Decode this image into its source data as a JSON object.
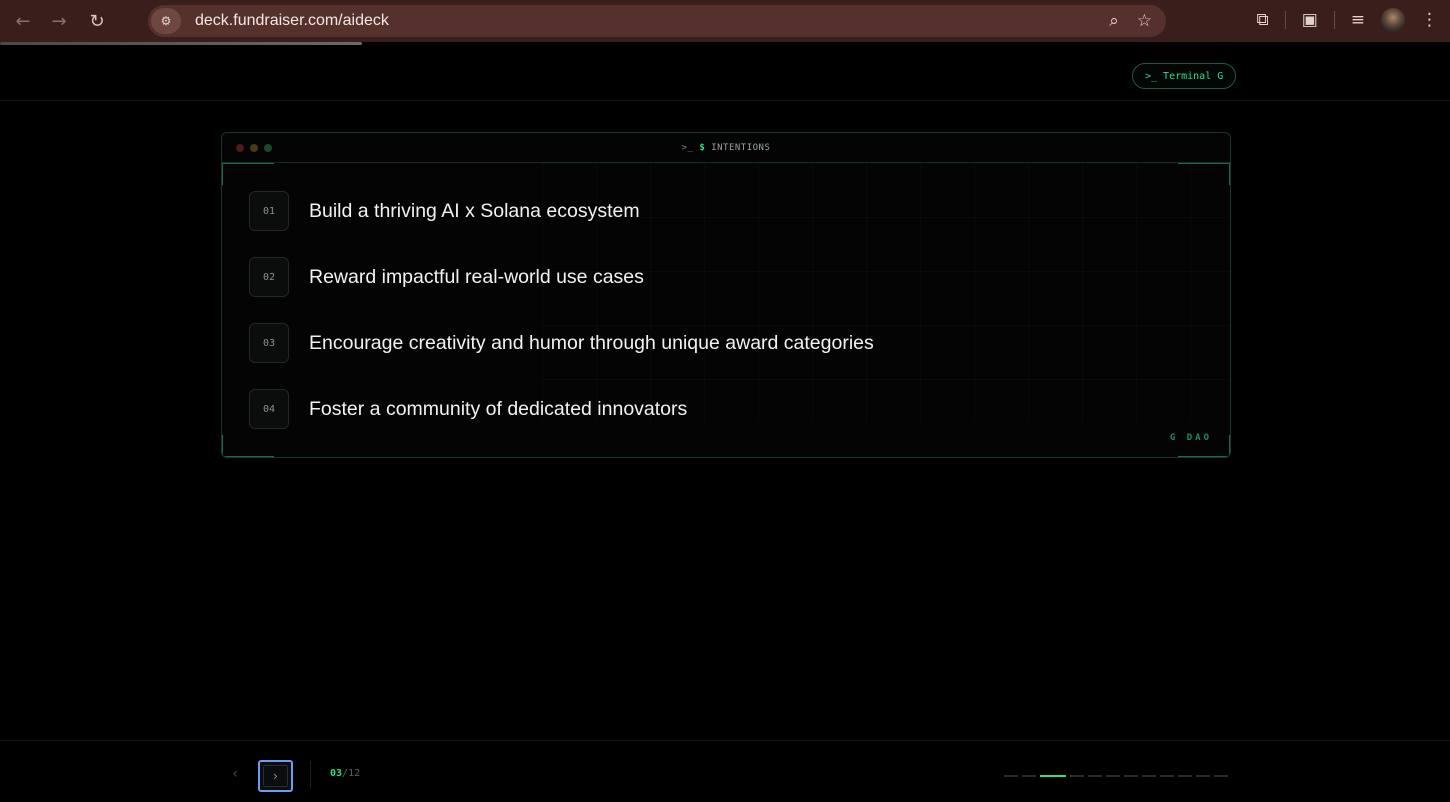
{
  "browser": {
    "url": "deck.fundraiser.com/aideck",
    "icons": [
      "back-arrow-icon",
      "forward-arrow-icon",
      "reload-icon",
      "site-settings-icon",
      "zoom-icon",
      "bookmark-star-icon",
      "extensions-icon",
      "tab-search-icon",
      "media-controls-icon",
      "profile-avatar",
      "menu-kebab-icon"
    ]
  },
  "header": {
    "terminal_pill": ">_ Terminal G"
  },
  "card": {
    "title_prompt": ">_",
    "title_dollar": "$",
    "title_text": "INTENTIONS",
    "items": [
      {
        "num": "01",
        "text": "Build a thriving AI x Solana ecosystem"
      },
      {
        "num": "02",
        "text": "Reward impactful real-world use cases"
      },
      {
        "num": "03",
        "text": "Encourage creativity and humor through unique award categories"
      },
      {
        "num": "04",
        "text": "Foster a community of dedicated innovators"
      }
    ],
    "brand_tag": "G DAO"
  },
  "footer": {
    "prev_label": "‹",
    "next_label": "›",
    "current_page": "03",
    "total_pages": "/12",
    "page_count": 12,
    "active_index": 2
  },
  "colors": {
    "accent": "#2fdc8c",
    "chrome_bg": "#3a1e1c",
    "background": "#000000",
    "focus_ring": "#6e9cf0"
  }
}
